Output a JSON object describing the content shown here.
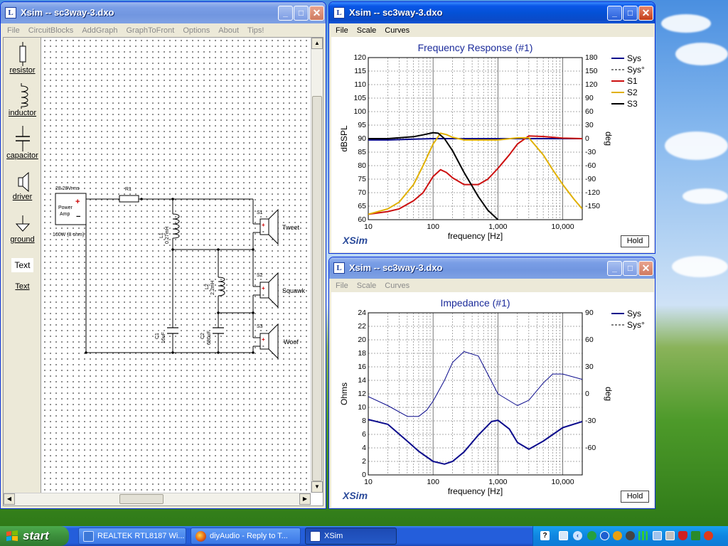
{
  "colors": {
    "sys": "#0a0a8c",
    "s1": "#cc1010",
    "s2": "#e0b000",
    "s3": "#000000"
  },
  "schematic_window": {
    "title": "Xsim -- sc3way-3.dxo",
    "menu": [
      "File",
      "CircuitBlocks",
      "AddGraph",
      "GraphToFront",
      "Options",
      "About",
      "Tips!"
    ],
    "palette": [
      "resistor",
      "inductor",
      "capacitor",
      "driver",
      "ground",
      "Text",
      "Text"
    ],
    "source": {
      "voltage": "28.28Vrms",
      "label_line1": "Power",
      "label_line2": "Amp",
      "rating": "100W (8 ohm)"
    },
    "parts": {
      "r1": "R1",
      "l1_name": "L1",
      "l1_value": "0.27mH",
      "l2_name": "L2",
      "l2_value": "2.2mH",
      "c1_name": "C1",
      "c1_value": "16uF",
      "c2_name": "C2",
      "c2_value": "680uF",
      "s1": "S1",
      "s2": "S2",
      "s3": "S3",
      "tweet": "Tweet",
      "squawk": "Squawk",
      "woof": "Woof"
    }
  },
  "freq_window": {
    "title": "Xsim -- sc3way-3.dxo",
    "menu": [
      "File",
      "Scale",
      "Curves"
    ],
    "graph_title": "Frequency Response (#1)",
    "ylabel_left": "dBSPL",
    "ylabel_right": "deg",
    "xlabel": "frequency [Hz]",
    "brand": "XSim",
    "hold_label": "Hold",
    "left_ticks": [
      "120",
      "115",
      "110",
      "105",
      "100",
      "95",
      "90",
      "85",
      "80",
      "75",
      "70",
      "65",
      "60"
    ],
    "right_ticks": [
      "180",
      "150",
      "120",
      "90",
      "60",
      "30",
      "0",
      "-30",
      "-60",
      "-90",
      "-120",
      "-150"
    ],
    "x_ticks": [
      "10",
      "100",
      "1,000",
      "10,000"
    ],
    "legend": [
      {
        "name": "Sys",
        "style": "solid",
        "color": "#0a0a8c"
      },
      {
        "name": "Sys°",
        "style": "dashed",
        "color": "#000000"
      },
      {
        "name": "S1",
        "style": "solid",
        "color": "#cc1010"
      },
      {
        "name": "S2",
        "style": "solid",
        "color": "#e0b000"
      },
      {
        "name": "S3",
        "style": "solid",
        "color": "#000000"
      }
    ]
  },
  "imp_window": {
    "title": "Xsim -- sc3way-3.dxo",
    "menu": [
      "File",
      "Scale",
      "Curves"
    ],
    "graph_title": "Impedance (#1)",
    "ylabel_left": "Ohms",
    "ylabel_right": "deg",
    "xlabel": "frequency [Hz]",
    "brand": "XSim",
    "hold_label": "Hold",
    "left_ticks": [
      "24",
      "22",
      "20",
      "18",
      "16",
      "14",
      "12",
      "10",
      "8",
      "6",
      "4",
      "2",
      "0"
    ],
    "right_ticks": [
      "90",
      "60",
      "30",
      "0",
      "-30",
      "-60"
    ],
    "x_ticks": [
      "10",
      "100",
      "1,000",
      "10,000"
    ],
    "legend": [
      {
        "name": "Sys",
        "style": "solid",
        "color": "#0a0a8c"
      },
      {
        "name": "Sys°",
        "style": "dashed",
        "color": "#000000"
      }
    ]
  },
  "taskbar": {
    "start": "start",
    "tasks": [
      "REALTEK RTL8187 Wi...",
      "diyAudio - Reply to T...",
      "XSim"
    ]
  },
  "chart_data": [
    {
      "type": "line",
      "title": "Frequency Response (#1)",
      "xlabel": "frequency [Hz]",
      "ylabel": "dBSPL",
      "y2label": "deg",
      "xscale": "log",
      "xlim": [
        10,
        20000
      ],
      "ylim": [
        60,
        120
      ],
      "y2lim": [
        -180,
        180
      ],
      "grid": true,
      "legend_position": "right",
      "series": [
        {
          "name": "Sys",
          "color": "#0a0a8c",
          "x": [
            10,
            20,
            50,
            100,
            200,
            500,
            1000,
            2000,
            5000,
            10000,
            20000
          ],
          "y": [
            89.5,
            89.5,
            89.8,
            90,
            90,
            90,
            90,
            90,
            90,
            90,
            90
          ]
        },
        {
          "name": "S1",
          "color": "#cc1010",
          "x": [
            10,
            20,
            30,
            50,
            70,
            100,
            130,
            160,
            200,
            300,
            500,
            700,
            1000,
            1500,
            2000,
            3000,
            5000,
            10000,
            20000
          ],
          "y": [
            62,
            63,
            64,
            67,
            70,
            76,
            78.5,
            77.5,
            75.5,
            73,
            73,
            75,
            79,
            84,
            88,
            91,
            90.8,
            90.2,
            90
          ]
        },
        {
          "name": "S2",
          "color": "#e0b000",
          "x": [
            10,
            20,
            30,
            50,
            70,
            100,
            130,
            160,
            200,
            300,
            500,
            1000,
            2000,
            3000,
            5000,
            7000,
            10000,
            15000,
            20000
          ],
          "y": [
            62,
            64,
            66.5,
            73,
            80,
            88,
            92,
            91.5,
            90.5,
            89.5,
            89.5,
            89.5,
            90.3,
            90.3,
            84,
            78.5,
            73,
            67.5,
            64
          ]
        },
        {
          "name": "S3",
          "color": "#000000",
          "x": [
            10,
            20,
            50,
            70,
            100,
            120,
            150,
            200,
            300,
            500,
            700,
            1000
          ],
          "y": [
            90,
            90,
            90.7,
            91.4,
            92.2,
            92,
            90,
            85.5,
            77.5,
            68.5,
            63.5,
            60
          ]
        }
      ]
    },
    {
      "type": "line",
      "title": "Impedance (#1)",
      "xlabel": "frequency [Hz]",
      "ylabel": "Ohms",
      "y2label": "deg",
      "xscale": "log",
      "xlim": [
        10,
        20000
      ],
      "ylim": [
        0,
        24
      ],
      "y2lim": [
        -90,
        90
      ],
      "grid": true,
      "legend_position": "right",
      "series": [
        {
          "name": "Sys",
          "color": "#0a0a8c",
          "axis": "left",
          "x": [
            10,
            20,
            40,
            60,
            100,
            150,
            200,
            300,
            500,
            800,
            1000,
            1500,
            2000,
            3000,
            5000,
            10000,
            20000
          ],
          "y": [
            8.2,
            7.5,
            5,
            3.5,
            2,
            1.6,
            2,
            3.4,
            5.9,
            7.9,
            8.1,
            6.8,
            4.8,
            3.8,
            5,
            7,
            7.9
          ]
        },
        {
          "name": "Sys°",
          "color": "#0a0a8c",
          "axis": "right",
          "x": [
            10,
            20,
            40,
            60,
            80,
            100,
            150,
            200,
            300,
            500,
            1000,
            2000,
            3000,
            5000,
            7000,
            10000,
            20000
          ],
          "y": [
            -3,
            -13,
            -25,
            -25,
            -18,
            -8,
            15,
            35,
            47,
            42,
            0,
            -13,
            -7,
            12,
            22,
            22,
            16
          ]
        }
      ]
    }
  ]
}
